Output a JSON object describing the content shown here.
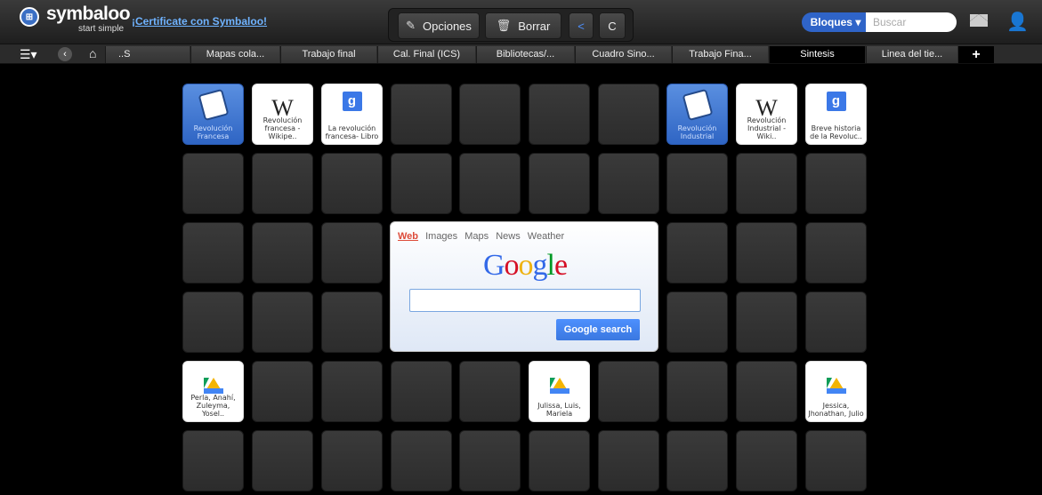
{
  "header": {
    "logo_text": "symbaloo",
    "logo_sub": "start simple",
    "cert_link": "¡Certificate con Symbaloo!",
    "options_label": "Opciones",
    "delete_label": "Borrar",
    "bloques_label": "Bloques ▾",
    "search_placeholder": "Buscar"
  },
  "tabs": {
    "first_partial": "..S",
    "items": [
      "Mapas cola...",
      "Trabajo final",
      "Cal. Final (ICS)",
      "Bibliotecas/...",
      "Cuadro Sino...",
      "Trabajo Fina...",
      "Sintesis",
      "Linea del tie..."
    ],
    "active": "Sintesis"
  },
  "tiles": {
    "t1": "Revolución Francesa",
    "t2": "Revolución francesa - Wikipe..",
    "t3": "La revolución francesa- Libro",
    "t4": "Revolución Industrial",
    "t5": "Revolución Industrial - Wiki..",
    "t6": "Breve historia de la Revoluc..",
    "t7": "Perla, Anahí, Zuleyma, Yosel..",
    "t8": "Julissa, Luis, Mariela",
    "t9": "Jessica, Jhonathan, Julio"
  },
  "google": {
    "tabs": [
      "Web",
      "Images",
      "Maps",
      "News",
      "Weather"
    ],
    "search_button": "Google search"
  },
  "colors": {
    "accent": "#2f64c8",
    "link": "#6fb3ff"
  }
}
